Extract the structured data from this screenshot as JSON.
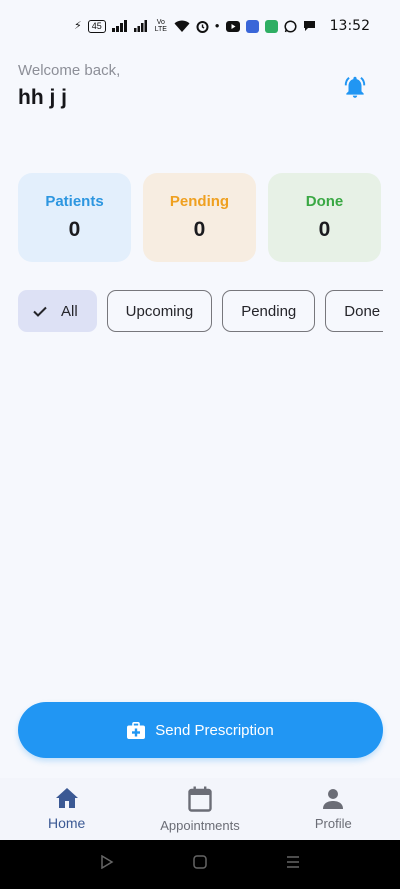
{
  "status_bar": {
    "battery": "45",
    "network": "4G",
    "volte": "Vo LTE",
    "time": "13:52"
  },
  "header": {
    "welcome": "Welcome back,",
    "username": "hh j j",
    "notification_icon": "bell-ring-icon"
  },
  "stats": [
    {
      "label": "Patients",
      "value": "0",
      "color": "#2d96e0"
    },
    {
      "label": "Pending",
      "value": "0",
      "color": "#efa020"
    },
    {
      "label": "Done",
      "value": "0",
      "color": "#3aa844"
    }
  ],
  "filters": {
    "selected": "All",
    "items": [
      "All",
      "Upcoming",
      "Pending",
      "Done"
    ]
  },
  "actions": {
    "send_prescription": "Send Prescription",
    "send_icon": "medical-bag-icon"
  },
  "bottom_nav": {
    "active": "Home",
    "items": [
      {
        "label": "Home",
        "icon": "home-icon"
      },
      {
        "label": "Appointments",
        "icon": "calendar-icon"
      },
      {
        "label": "Profile",
        "icon": "person-icon"
      }
    ]
  },
  "colors": {
    "accent": "#2196f3",
    "background": "#f6f8fd",
    "nav_active": "#3b5994"
  }
}
